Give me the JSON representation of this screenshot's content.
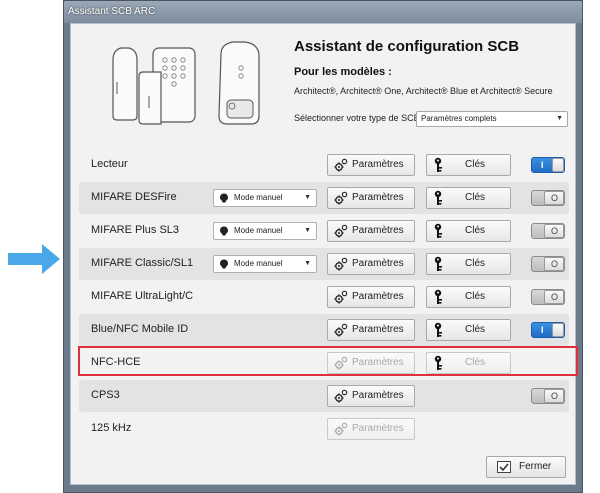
{
  "window": {
    "title": "Assistant SCB ARC"
  },
  "header": {
    "title": "Assistant de configuration SCB",
    "subtitle": "Pour les modèles :",
    "models": "Architect®, Architect® One, Architect® Blue et Architect® Secure",
    "type_label": "Sélectionner votre type de SCB",
    "type_value": "Paramètres complets"
  },
  "labels": {
    "params": "Paramètres",
    "keys": "Clés",
    "close": "Fermer"
  },
  "rows": [
    {
      "name": "Lecteur",
      "mode": null,
      "params_enabled": true,
      "keys": true,
      "keys_enabled": true,
      "toggle": "on"
    },
    {
      "name": "MIFARE DESFire",
      "mode": "Mode manuel",
      "params_enabled": true,
      "keys": true,
      "keys_enabled": true,
      "toggle": "off"
    },
    {
      "name": "MIFARE Plus SL3",
      "mode": "Mode manuel",
      "params_enabled": true,
      "keys": true,
      "keys_enabled": true,
      "toggle": "off"
    },
    {
      "name": "MIFARE Classic/SL1",
      "mode": "Mode manuel",
      "params_enabled": true,
      "keys": true,
      "keys_enabled": true,
      "toggle": "off"
    },
    {
      "name": "MIFARE UltraLight/C",
      "mode": null,
      "params_enabled": true,
      "keys": true,
      "keys_enabled": true,
      "toggle": "off"
    },
    {
      "name": "Blue/NFC Mobile ID",
      "mode": null,
      "params_enabled": true,
      "keys": true,
      "keys_enabled": true,
      "toggle": "on"
    },
    {
      "name": "NFC-HCE",
      "mode": null,
      "params_enabled": false,
      "keys": true,
      "keys_enabled": false,
      "toggle": null
    },
    {
      "name": "CPS3",
      "mode": null,
      "params_enabled": true,
      "keys": false,
      "keys_enabled": false,
      "toggle": "off"
    },
    {
      "name": "125 kHz",
      "mode": null,
      "params_enabled": false,
      "keys": false,
      "keys_enabled": false,
      "toggle": null
    }
  ],
  "colors": {
    "accent_arrow": "#4aa8e8",
    "toggle_on": "#2a7ed6",
    "highlight": "#e0303c"
  },
  "icons": {
    "arrow": "arrow-right-icon",
    "params": "gears-icon",
    "keys": "key-icon",
    "mode": "chip-icon",
    "close": "checkbox-icon"
  }
}
